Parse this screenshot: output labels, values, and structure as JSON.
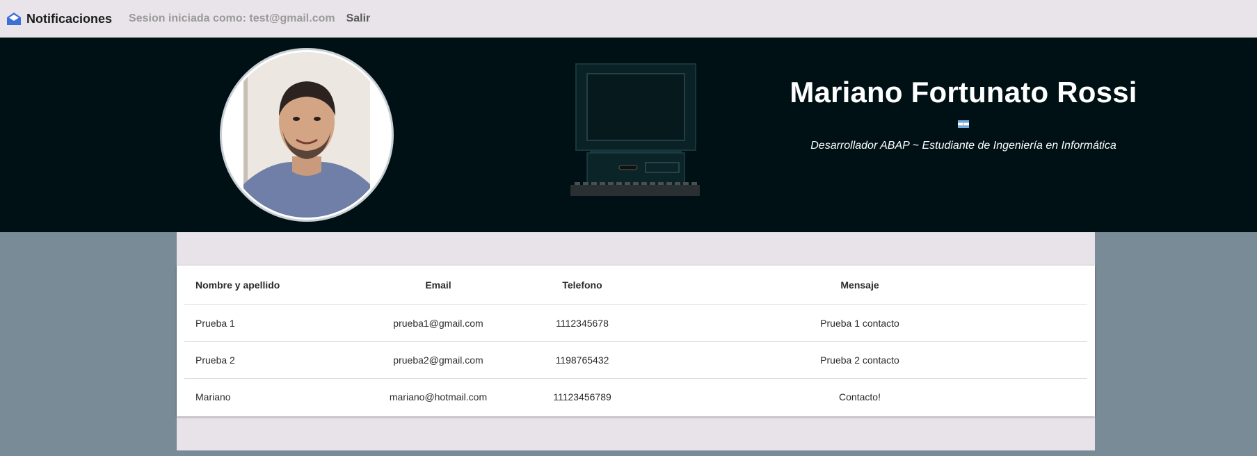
{
  "navbar": {
    "brand_icon": "envelope-open-icon",
    "brand_label": "Notificaciones",
    "session_text": "Sesion iniciada como: test@gmail.com",
    "logout_label": "Salir"
  },
  "hero": {
    "name": "Mariano Fortunato Rossi",
    "flag_icon": "argentina-flag-icon",
    "subtitle": "Desarrollador ABAP ~ Estudiante de Ingeniería en Informática",
    "background_color": "#001116"
  },
  "table": {
    "headers": [
      "Nombre y apellido",
      "Email",
      "Telefono",
      "Mensaje"
    ],
    "rows": [
      [
        "Prueba 1",
        "prueba1@gmail.com",
        "1112345678",
        "Prueba 1 contacto"
      ],
      [
        "Prueba 2",
        "prueba2@gmail.com",
        "1198765432",
        "Prueba 2 contacto"
      ],
      [
        "Mariano",
        "mariano@hotmail.com",
        "11123456789",
        "Contacto!"
      ]
    ]
  },
  "colors": {
    "navbar_bg": "#e9e4ea",
    "page_bg": "#7a8b98",
    "brand_icon": "#3b6fd6"
  }
}
